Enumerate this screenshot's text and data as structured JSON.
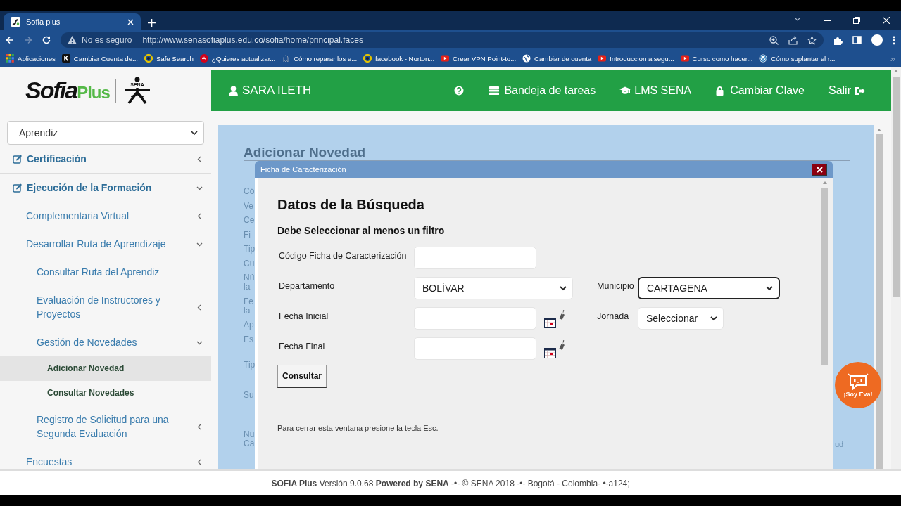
{
  "browser": {
    "tabs": [
      {
        "title": "Sofia plus",
        "selected": true
      }
    ],
    "address": {
      "security": "No es seguro",
      "url": "http://www.senasofiaplus.edu.co/sofia/home/principal.faces"
    },
    "bookmarks": [
      {
        "label": "Aplicaciones",
        "kind": "apps"
      },
      {
        "label": "Cambiar Cuenta de...",
        "kind": "letter"
      },
      {
        "label": "Safe Search",
        "kind": "ring"
      },
      {
        "label": "¿Quieres actualizar...",
        "kind": "badge"
      },
      {
        "label": "Cómo reparar los e...",
        "kind": "faint"
      },
      {
        "label": "facebook - Norton...",
        "kind": "ring"
      },
      {
        "label": "Crear VPN Point-to...",
        "kind": "video"
      },
      {
        "label": "Cambiar de cuenta",
        "kind": "globe"
      },
      {
        "label": "Introduccion a segu...",
        "kind": "video"
      },
      {
        "label": "Curso como hacer...",
        "kind": "video"
      },
      {
        "label": "Cómo suplantar el r...",
        "kind": "wp"
      }
    ],
    "more": "»"
  },
  "logo": {
    "name": "Sofia",
    "suffix": "Plus",
    "mark": "SENA"
  },
  "role_select": {
    "value": "Aprendiz"
  },
  "sidebar": {
    "items": [
      {
        "label": "Certificación",
        "expanded": false,
        "selected": false
      },
      {
        "label": "Ejecución de la Formación",
        "expanded": true,
        "selected": false,
        "children": [
          {
            "label": "Complementaria Virtual",
            "expanded": false,
            "selected": false
          },
          {
            "label": "Desarrollar Ruta de Aprendizaje",
            "expanded": true,
            "selected": false,
            "children": [
              {
                "label": "Consultar Ruta del Aprendiz",
                "selected": false
              },
              {
                "label": "Evaluación de Instructores y Proyectos",
                "expanded": false,
                "selected": false
              },
              {
                "label": "Gestión de Novedades",
                "expanded": true,
                "selected": false,
                "children": [
                  {
                    "label": "Adicionar Novedad",
                    "selected": true
                  },
                  {
                    "label": "Consultar Novedades",
                    "selected": false
                  }
                ]
              },
              {
                "label": "Registro de Solicitud para una Segunda Evaluación",
                "expanded": false,
                "selected": false
              }
            ]
          },
          {
            "label": "Encuestas",
            "expanded": false,
            "selected": false
          }
        ]
      }
    ]
  },
  "header": {
    "user": "SARA ILETH",
    "links": [
      {
        "kind": "help"
      },
      {
        "kind": "tasks",
        "label": "Bandeja de tareas"
      },
      {
        "kind": "lms",
        "label": "LMS SENA"
      },
      {
        "kind": "lock",
        "label": "Cambiar Clave"
      },
      {
        "kind": "exit",
        "label": "Salir"
      }
    ]
  },
  "page": {
    "title": "Adicionar Novedad",
    "background_labels": [
      "Có",
      "Ve",
      "Ce",
      "Fi",
      "Tip",
      "Cu",
      "Nú la",
      "Fe la",
      "Ap",
      "Es",
      "Tip",
      "Su",
      "Nu Ca"
    ],
    "background_fragment": "ud"
  },
  "dialog": {
    "title": "Ficha de Caracterización",
    "heading": "Datos de la Búsqueda",
    "instruction": "Debe Seleccionar al menos un filtro",
    "rows": [
      [
        {
          "label": "Código Ficha de Caracterización",
          "kind": "text",
          "focused": false
        }
      ],
      [
        {
          "label": "Departamento",
          "kind": "select",
          "value": "BOLÍVAR",
          "focused": false
        },
        {
          "label": "Municipio",
          "kind": "select",
          "value": "CARTAGENA",
          "focused": true
        }
      ],
      [
        {
          "label": "Fecha Inicial",
          "kind": "date",
          "focused": false
        },
        {
          "label": "Jornada",
          "kind": "select",
          "value": "Seleccionar",
          "focused": false
        }
      ],
      [
        {
          "label": "Fecha Final",
          "kind": "date",
          "focused": false
        }
      ]
    ],
    "button": "Consultar",
    "hint": "Para cerrar esta ventana presione la tecla Esc."
  },
  "assistant": {
    "label": "¡Soy Eva!"
  },
  "footer": "**SOFIA Plus** Versión 9.0.68 **Powered by SENA** -•- © SENA 2018 -•- Bogotá - Colombia- •-a124;"
}
